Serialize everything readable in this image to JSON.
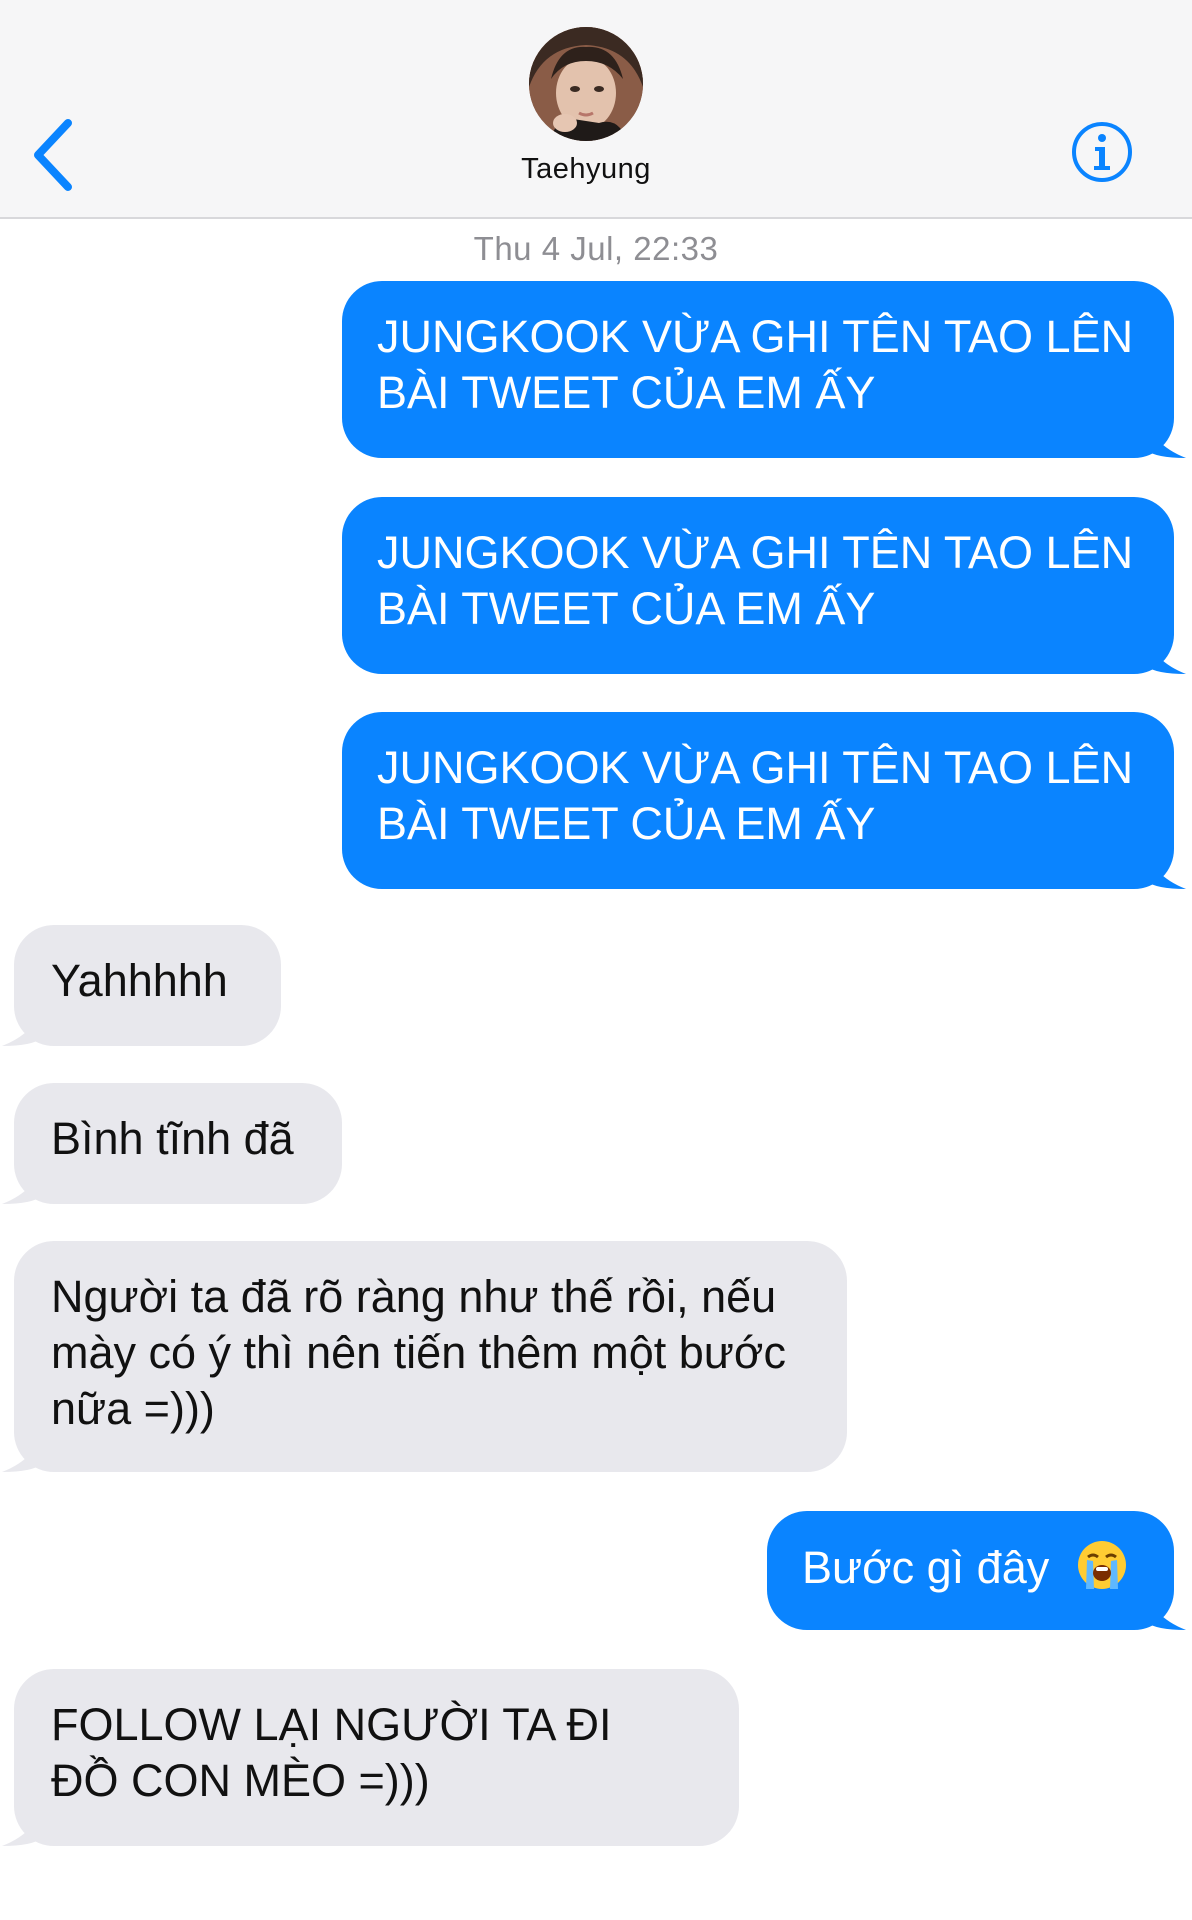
{
  "header": {
    "contact_name": "Taehyung",
    "back_icon": "chevron-left-icon",
    "info_icon": "info-circle-icon",
    "accent_color": "#0a84ff"
  },
  "timestamp": "Thu 4 Jul, 22:33",
  "messages": [
    {
      "direction": "outgoing",
      "text": "JUNGKOOK VỪA GHI TÊN TAO LÊN BÀI TWEET CỦA EM ẤY"
    },
    {
      "direction": "outgoing",
      "text": "JUNGKOOK VỪA GHI TÊN TAO LÊN BÀI TWEET CỦA EM ẤY"
    },
    {
      "direction": "outgoing",
      "text": "JUNGKOOK VỪA GHI TÊN TAO LÊN BÀI TWEET CỦA EM ẤY"
    },
    {
      "direction": "incoming",
      "text": "Yahhhhh"
    },
    {
      "direction": "incoming",
      "text": "Bình tĩnh đã"
    },
    {
      "direction": "incoming",
      "text": "Người ta đã rõ ràng như thế rồi, nếu mày có ý thì nên tiến thêm một bước nữa =)))"
    },
    {
      "direction": "outgoing",
      "text": "Bước gì đây",
      "emoji": "loudly-crying-face-icon"
    },
    {
      "direction": "incoming",
      "text": "FOLLOW LẠI NGƯỜI TA ĐI ĐỒ CON MÈO =)))"
    }
  ],
  "colors": {
    "outgoing_bubble": "#0a84ff",
    "incoming_bubble": "#e8e8ed"
  }
}
